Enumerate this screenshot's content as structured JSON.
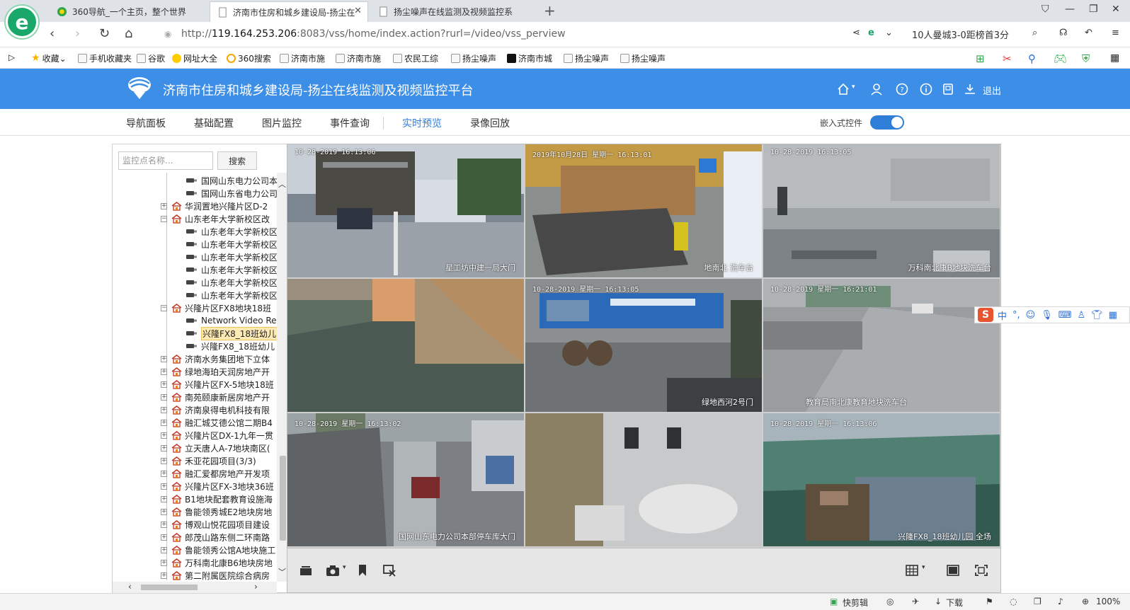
{
  "browser": {
    "tabs": [
      {
        "title": "360导航_一个主页，整个世界",
        "active": false
      },
      {
        "title": "济南市住房和城乡建设局-扬尘在",
        "active": true
      },
      {
        "title": "扬尘噪声在线监测及视频监控系",
        "active": false
      }
    ],
    "url_prefix": "http://",
    "url_host": "119.164.253.206",
    "url_rest": ":8083/vss/home/index.action?rurl=/video/vss_perview",
    "news_ticker": "10人曼城3-0距榜首3分",
    "bookmarks": [
      "收藏",
      "手机收藏夹",
      "谷歌",
      "网址大全",
      "360搜索",
      "济南市施",
      "济南市施",
      "农民工综",
      "扬尘噪声",
      "济南市城",
      "扬尘噪声",
      "扬尘噪声"
    ]
  },
  "app": {
    "title": "济南市住房和城乡建设局-扬尘在线监测及视频监控平台",
    "logout": "退出",
    "nav": [
      {
        "label": "导航面板",
        "active": false
      },
      {
        "label": "基础配置",
        "active": false
      },
      {
        "label": "图片监控",
        "active": false
      },
      {
        "label": "事件查询",
        "active": false
      },
      {
        "label": "实时预览",
        "active": true
      },
      {
        "label": "录像回放",
        "active": false
      }
    ],
    "embed_label": "嵌入式控件",
    "embed_enabled": true
  },
  "search": {
    "placeholder": "监控点名称...",
    "button": "搜索"
  },
  "tree": [
    {
      "type": "cam",
      "label": "国网山东电力公司本",
      "level": 2
    },
    {
      "type": "cam",
      "label": "国网山东省电力公司",
      "level": 2
    },
    {
      "type": "site",
      "label": "华润置地兴隆片区D-2",
      "expanded": false
    },
    {
      "type": "site",
      "label": "山东老年大学新校区改",
      "expanded": true
    },
    {
      "type": "cam",
      "label": "山东老年大学新校区",
      "level": 2
    },
    {
      "type": "cam",
      "label": "山东老年大学新校区",
      "level": 2
    },
    {
      "type": "cam",
      "label": "山东老年大学新校区",
      "level": 2
    },
    {
      "type": "cam",
      "label": "山东老年大学新校区",
      "level": 2
    },
    {
      "type": "cam",
      "label": "山东老年大学新校区",
      "level": 2
    },
    {
      "type": "cam",
      "label": "山东老年大学新校区",
      "level": 2
    },
    {
      "type": "site",
      "label": "兴隆片区FX8地块18班",
      "expanded": true
    },
    {
      "type": "cam",
      "label": "Network Video Re",
      "level": 2
    },
    {
      "type": "cam",
      "label": "兴隆FX8_18班幼儿",
      "level": 2,
      "selected": true
    },
    {
      "type": "cam",
      "label": "兴隆FX8_18班幼儿",
      "level": 2
    },
    {
      "type": "site",
      "label": "济南水务集团地下立体",
      "expanded": false
    },
    {
      "type": "site",
      "label": "绿地海珀天润房地产开",
      "expanded": false
    },
    {
      "type": "site",
      "label": "兴隆片区FX-5地块18班",
      "expanded": false
    },
    {
      "type": "site",
      "label": "南苑颐康新居房地产开",
      "expanded": false
    },
    {
      "type": "site",
      "label": "济南泉得电机科技有限",
      "expanded": false
    },
    {
      "type": "site",
      "label": "融汇城艾德公馆二期B4",
      "expanded": false
    },
    {
      "type": "site",
      "label": "兴隆片区DX-1九年一贯",
      "expanded": false
    },
    {
      "type": "site",
      "label": "立天唐人A-7地块南区(",
      "expanded": false
    },
    {
      "type": "site",
      "label": "禾亚花园项目(3/3)",
      "expanded": false
    },
    {
      "type": "site",
      "label": "融汇爱都房地产开发项",
      "expanded": false
    },
    {
      "type": "site",
      "label": "兴隆片区FX-3地块36班",
      "expanded": false
    },
    {
      "type": "site",
      "label": "B1地块配套教育设施海",
      "expanded": false
    },
    {
      "type": "site",
      "label": "鲁能领秀城E2地块房地",
      "expanded": false
    },
    {
      "type": "site",
      "label": "博观山悦花园项目建设",
      "expanded": false
    },
    {
      "type": "site",
      "label": "郎茂山路东侧二环南路",
      "expanded": false
    },
    {
      "type": "site",
      "label": "鲁能领秀公馆A地块施工",
      "expanded": false
    },
    {
      "type": "site",
      "label": "万科南北康B6地块房地",
      "expanded": false
    },
    {
      "type": "site",
      "label": "第二附属医院综合病房",
      "expanded": false
    }
  ],
  "videos": [
    {
      "timestamp": "10-28-2019 16:13:06",
      "caption": "星工坊中建一局大门",
      "scene": "campus"
    },
    {
      "timestamp": "2019年10月28日 星期一 16:13:01",
      "caption": "地南北 洗车台",
      "scene": "washpad"
    },
    {
      "timestamp": "10-28-2019 16:13:05",
      "caption": "万科南北康B地块洗车台",
      "scene": "fog"
    },
    {
      "timestamp": "",
      "caption": "",
      "scene": "netting"
    },
    {
      "timestamp": "10-28-2019 星期一 16:13:05",
      "caption": "",
      "scene": "gate"
    },
    {
      "timestamp": "10-28-2019 星期一 16:21:01",
      "caption": "",
      "scene": "road"
    },
    {
      "timestamp": "10-28-2019 星期一 16:13:02",
      "caption": "国网山东电力公司本部停车库大门",
      "scene": "street"
    },
    {
      "timestamp": "",
      "caption": "",
      "scene": "mixer"
    },
    {
      "timestamp": "10-28-2019 星期一 16:13:06",
      "caption": "兴隆FX8_18班幼儿园 全场",
      "scene": "greensite"
    }
  ],
  "video_overlays": {
    "cell5_caption": "绿地西河2号门",
    "cell6_caption": "教育局南北康教育地块洗车台"
  },
  "ime": {
    "label": "中"
  },
  "status": {
    "kuaijianji": "快剪辑",
    "download": "下载",
    "zoom": "100%"
  },
  "colors": {
    "header_blue": "#3d8ee6",
    "nav_active": "#2f7fd9",
    "selected_cell": "#f5e12a"
  }
}
